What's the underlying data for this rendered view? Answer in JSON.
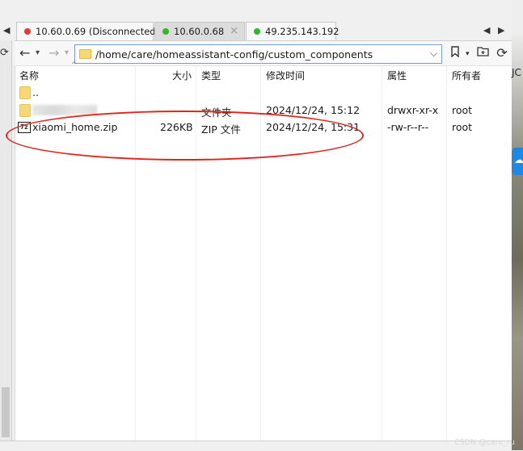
{
  "tabs": [
    {
      "label": "10.60.0.69 (Disconnected)",
      "status_color": "#e53935"
    },
    {
      "label": "10.60.0.68",
      "status_color": "#2db82d",
      "close": "×"
    },
    {
      "label": "49.235.143.192",
      "status_color": "#2db82d"
    }
  ],
  "tab_nav": {
    "left": "◀",
    "right": "▶"
  },
  "toolbar": {
    "back": "←",
    "back_dropdown": "▾",
    "forward": "→",
    "forward_dropdown": "▾",
    "path": "/home/care/homeassistant-config/custom_components",
    "path_dropdown": "⌵"
  },
  "columns": {
    "name": "名称",
    "size": "大小",
    "type": "类型",
    "modified": "修改时间",
    "attributes": "属性",
    "owner": "所有者"
  },
  "rows": [
    {
      "name": "..",
      "size": "",
      "type": "",
      "modified": "",
      "attributes": "",
      "owner": ""
    },
    {
      "name": "",
      "size": "",
      "type": "文件夹",
      "modified": "2024/12/24, 15:12",
      "attributes": "drwxr-xr-x",
      "owner": "root"
    },
    {
      "name": "xiaomi_home.zip",
      "size": "226KB",
      "type": "ZIP 文件",
      "modified": "2024/12/24, 15:31",
      "attributes": "-rw-r--r--",
      "owner": "root"
    }
  ],
  "zip_icon_text": "7z",
  "edge_text": "JC",
  "watermark": "CSDN @care_ru",
  "colors": {
    "annotation": "#e2231a",
    "accent": "#1e88e5"
  }
}
